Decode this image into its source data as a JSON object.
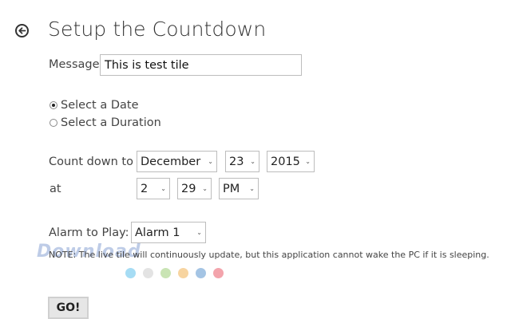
{
  "header": {
    "title": "Setup the Countdown",
    "back_icon": "back-arrow-icon"
  },
  "message": {
    "label": "Message",
    "value": "This is test tile"
  },
  "mode": {
    "options": [
      {
        "label": "Select a Date",
        "selected": true
      },
      {
        "label": "Select a Duration",
        "selected": false
      }
    ]
  },
  "countdown": {
    "label": "Count down to",
    "month": "December",
    "day": "23",
    "year": "2015"
  },
  "time": {
    "label": "at",
    "hour": "2",
    "minute": "29",
    "ampm": "PM"
  },
  "alarm": {
    "label": "Alarm to Play:",
    "value": "Alarm 1"
  },
  "note": "NOTE: The live tile will continuously update, but this application cannot wake the PC if it is sleeping.",
  "watermark": "Download",
  "color_dots": [
    "#a6dcf4",
    "#e3e3e3",
    "#c9e4b4",
    "#f7d4a0",
    "#a4c4e4",
    "#f3a4ac"
  ],
  "go_button": {
    "label": "GO!"
  }
}
